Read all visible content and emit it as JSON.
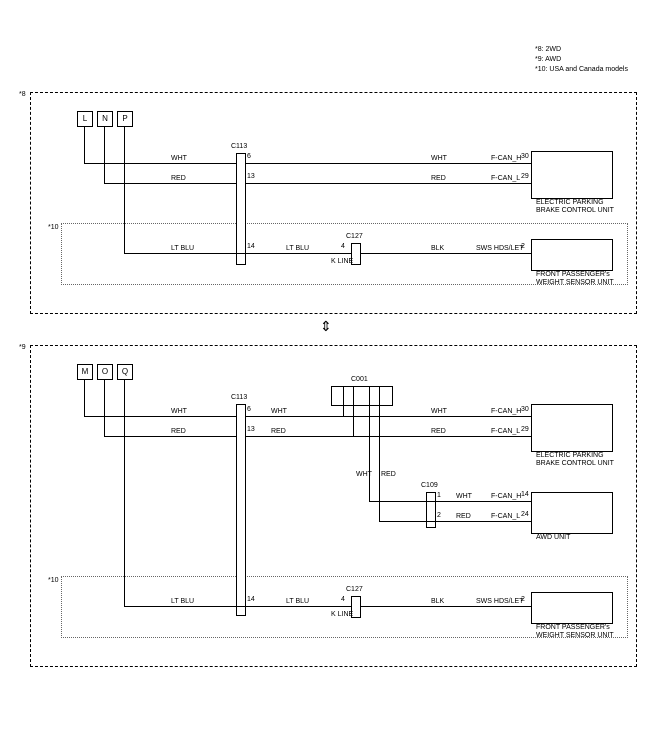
{
  "legend": {
    "l1": "*8: 2WD",
    "l2": "*9: AWD",
    "l3": "*10: USA and Canada models"
  },
  "box8_label": "*8",
  "box9_label": "*9",
  "dot10_label": "*10",
  "terms8": {
    "a": "L",
    "b": "N",
    "c": "P"
  },
  "terms9": {
    "a": "M",
    "b": "O",
    "c": "Q"
  },
  "colors": {
    "wht": "WHT",
    "red": "RED",
    "ltblu": "LT BLU",
    "blk": "BLK"
  },
  "conn8": {
    "c113": "C113",
    "c127": "C127"
  },
  "conn9": {
    "c113": "C113",
    "c001": "C001",
    "c109": "C109",
    "c127": "C127"
  },
  "pins8": {
    "c113_wht": "6",
    "c113_red": "13",
    "c113_ltblu": "14",
    "c127_ltblu": "4",
    "epb_wht": "30",
    "epb_red": "29",
    "fpws_blk": "2"
  },
  "pins9": {
    "c113_wht": "6",
    "c113_red": "13",
    "c113_ltblu": "14",
    "c127_ltblu": "4",
    "epb_wht": "30",
    "epb_red": "29",
    "c109_wht": "1",
    "c109_red": "2",
    "awd_wht": "14",
    "awd_red": "24",
    "fpws_blk": "2"
  },
  "sigs": {
    "fcanh": "F-CAN_H",
    "fcanl": "F-CAN_L",
    "kline": "K LINE",
    "sws": "SWS HDS/LET"
  },
  "comp": {
    "epb": "ELECTRIC PARKING BRAKE CONTROL UNIT",
    "fpws": "FRONT PASSENGER's WEIGHT SENSOR UNIT",
    "awd": "AWD UNIT"
  },
  "chart_data": [
    {
      "type": "table",
      "title": "*8 2WD wiring",
      "rows": [
        {
          "from": "L",
          "to": "ELECTRIC PARKING BRAKE CONTROL UNIT",
          "to_pin": 30,
          "signal": "F-CAN_H",
          "via": [
            {
              "conn": "C113",
              "pin": 6
            }
          ],
          "color": "WHT"
        },
        {
          "from": "N",
          "to": "ELECTRIC PARKING BRAKE CONTROL UNIT",
          "to_pin": 29,
          "signal": "F-CAN_L",
          "via": [
            {
              "conn": "C113",
              "pin": 13
            }
          ],
          "color": "RED"
        },
        {
          "from": "P",
          "to": "FRONT PASSENGER's WEIGHT SENSOR UNIT",
          "to_pin": 2,
          "signal": "SWS HDS/LET",
          "via": [
            {
              "conn": "C113",
              "pin": 14,
              "segment_color": "LT BLU"
            },
            {
              "conn": "C127",
              "pin": 4,
              "segment_color": "LT BLU"
            }
          ],
          "color_after": "BLK",
          "k_line_label_at": "C127"
        }
      ],
      "note": "*10 USA and Canada models encloses SWS line and FRONT PASSENGER's WEIGHT SENSOR UNIT"
    },
    {
      "type": "table",
      "title": "*9 AWD wiring",
      "rows": [
        {
          "from": "M",
          "to": "ELECTRIC PARKING BRAKE CONTROL UNIT",
          "to_pin": 30,
          "signal": "F-CAN_H",
          "via": [
            {
              "conn": "C113",
              "pin": 6
            },
            {
              "conn": "C001"
            }
          ],
          "color": "WHT"
        },
        {
          "from": "O",
          "to": "ELECTRIC PARKING BRAKE CONTROL UNIT",
          "to_pin": 29,
          "signal": "F-CAN_L",
          "via": [
            {
              "conn": "C113",
              "pin": 13
            },
            {
              "conn": "C001"
            }
          ],
          "color": "RED"
        },
        {
          "branch_from": "C001",
          "to": "AWD UNIT",
          "to_pin": 14,
          "signal": "F-CAN_H",
          "via": [
            {
              "conn": "C109",
              "pin": 1
            }
          ],
          "color": "WHT"
        },
        {
          "branch_from": "C001",
          "to": "AWD UNIT",
          "to_pin": 24,
          "signal": "F-CAN_L",
          "via": [
            {
              "conn": "C109",
              "pin": 2
            }
          ],
          "color": "RED"
        },
        {
          "from": "Q",
          "to": "FRONT PASSENGER's WEIGHT SENSOR UNIT",
          "to_pin": 2,
          "signal": "SWS HDS/LET",
          "via": [
            {
              "conn": "C113",
              "pin": 14,
              "segment_color": "LT BLU"
            },
            {
              "conn": "C127",
              "pin": 4,
              "segment_color": "LT BLU"
            }
          ],
          "color_after": "BLK",
          "k_line_label_at": "C127"
        }
      ],
      "note": "*10 USA and Canada models encloses SWS line and FRONT PASSENGER's WEIGHT SENSOR UNIT"
    }
  ]
}
